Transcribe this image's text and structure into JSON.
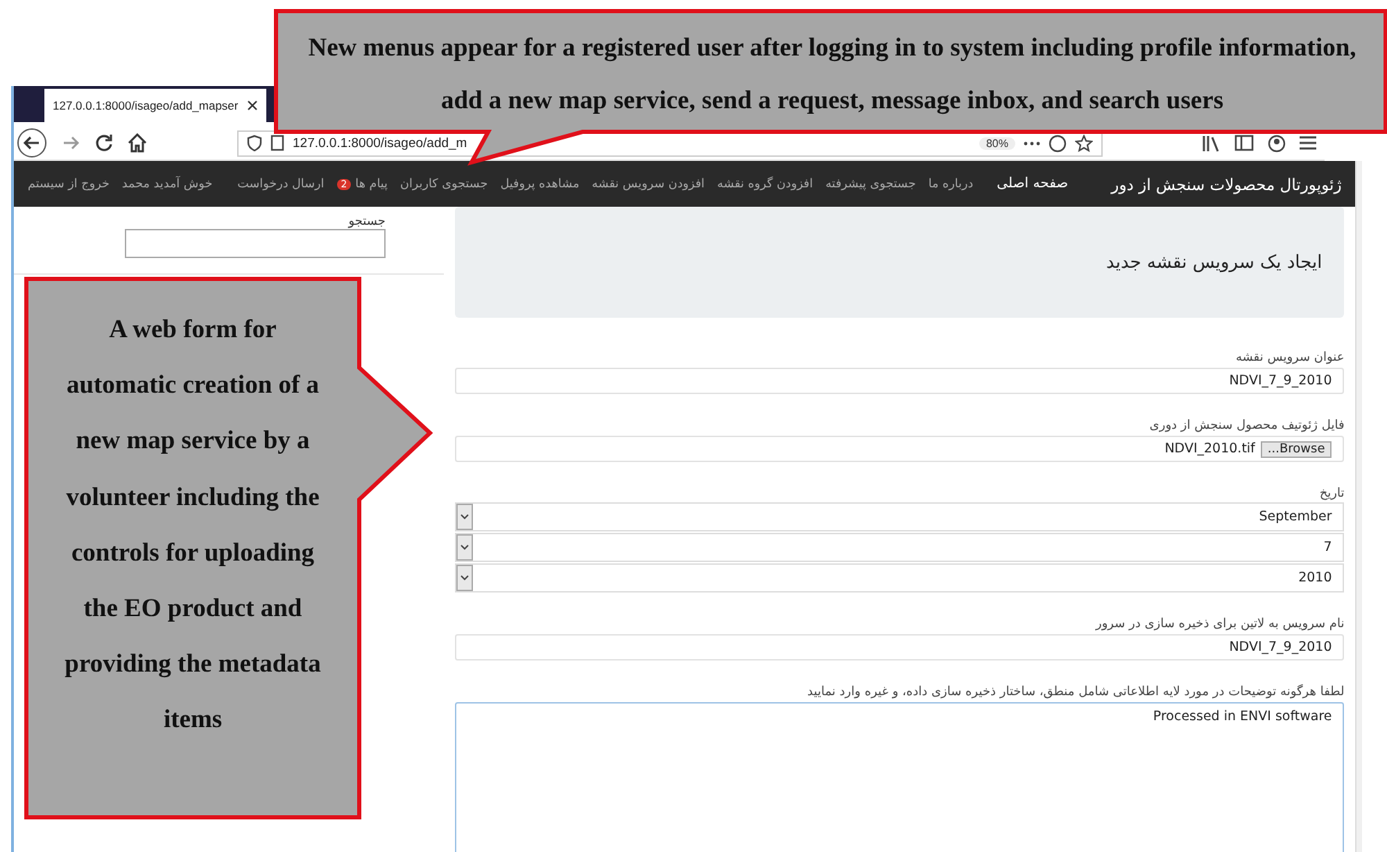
{
  "browser": {
    "tab_title": "127.0.0.1:8000/isageo/add_mapser",
    "url": "127.0.0.1:8000/isageo/add_m",
    "zoom": "80%"
  },
  "navbar": {
    "brand": "ژئوپورتال محصولات سنجش از دور",
    "items": [
      {
        "label": "صفحه اصلی",
        "selected": true
      },
      {
        "label": "درباره ما",
        "selected": false
      },
      {
        "label": "جستجوی پیشرفته",
        "selected": false
      },
      {
        "label": "افزودن گروه نقشه",
        "selected": false
      },
      {
        "label": "افزودن سرویس نقشه",
        "selected": false
      },
      {
        "label": "مشاهده پروفیل",
        "selected": false
      },
      {
        "label": "جستجوی کاربران",
        "selected": false
      },
      {
        "label": "پیام ها",
        "selected": false,
        "badge": "2"
      },
      {
        "label": "ارسال درخواست",
        "selected": false
      }
    ],
    "user_items": [
      "خوش آمدید محمد",
      "خروج از سیستم"
    ]
  },
  "sidebar": {
    "search_label": "جستجو"
  },
  "form": {
    "title": "ایجاد یک سرویس نقشه جدید",
    "fields": [
      {
        "kind": "text",
        "label": "عنوان سرویس نقشه",
        "value": "NDVI_7_9_2010"
      },
      {
        "kind": "file",
        "label": "فایل ژئوتیف محصول سنجش از دوری",
        "value": "NDVI_2010.tif",
        "button": "...Browse"
      },
      {
        "kind": "selects",
        "label": "تاریخ",
        "values": [
          "September",
          "7",
          "2010"
        ]
      },
      {
        "kind": "text",
        "label": "نام سرویس به لاتین برای ذخیره سازی در سرور",
        "value": "NDVI_7_9_2010"
      },
      {
        "kind": "textarea",
        "label": "لطفا هرگونه توضیحات در مورد لایه اطلاعاتی شامل منطق، ساختار ذخیره سازی داده، و غیره وارد نمایید",
        "value": "Processed in ENVI software"
      }
    ]
  },
  "annotations": {
    "top": "New menus appear for a registered user after logging in to system including profile information, add a new map service, send a request, message inbox, and search users",
    "side": "A web form for automatic creation of a new map service by a volunteer including the controls for uploading the EO product and providing the metadata items"
  }
}
